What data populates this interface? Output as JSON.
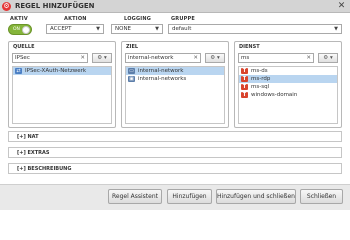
{
  "window": {
    "title": "REGEL HINZUFÜGEN"
  },
  "controls": {
    "aktiv": {
      "label": "AKTIV",
      "toggle_text": "ON"
    },
    "aktion": {
      "label": "AKTION",
      "value": "ACCEPT"
    },
    "logging": {
      "label": "LOGGING",
      "value": "NONE"
    },
    "gruppe": {
      "label": "GRUPPE",
      "value": "default"
    }
  },
  "panels": {
    "quelle": {
      "title": "QUELLE",
      "search": "IPSec",
      "items": [
        {
          "label": "IPSec-XAuth-Netzwerk",
          "icon": "network-icon",
          "selected": true
        }
      ]
    },
    "ziel": {
      "title": "ZIEL",
      "search": "internal-network",
      "items": [
        {
          "label": "internal-network",
          "icon": "network-icon",
          "selected": true
        },
        {
          "label": "internal-networks",
          "icon": "network-group-icon",
          "selected": false
        }
      ]
    },
    "dienst": {
      "title": "DIENST",
      "search": "ms",
      "items": [
        {
          "label": "ms-ds",
          "icon": "service-icon",
          "selected": false
        },
        {
          "label": "ms-rdp",
          "icon": "service-icon",
          "selected": true
        },
        {
          "label": "ms-sql",
          "icon": "service-icon",
          "selected": false
        },
        {
          "label": "windows-domain",
          "icon": "service-icon",
          "selected": false
        }
      ]
    }
  },
  "sections": [
    "[+] NAT",
    "[+] EXTRAS",
    "[+] BESCHREIBUNG"
  ],
  "footer": {
    "regel_assistent": "Regel Assistent",
    "hinzufuegen": "Hinzufügen",
    "hinzufuegen_schliessen": "Hinzufügen und schließen",
    "schliessen": "Schließen"
  },
  "colors": {
    "toggle_on": "#85b53a",
    "selection": "#b9d5f0",
    "service_icon": "#d9442e",
    "logo": "#e53535"
  }
}
